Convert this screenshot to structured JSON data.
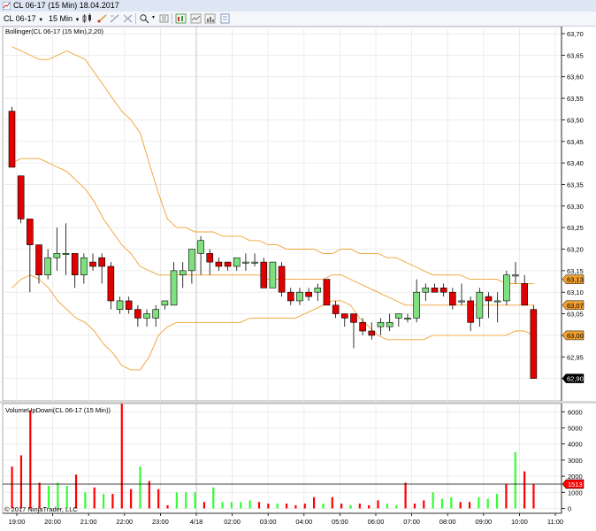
{
  "window": {
    "title": "CL 06-17 (15 Min)",
    "date": "18.04.2017"
  },
  "toolbar": {
    "instrument": "CL 06-17",
    "interval": "15 Min"
  },
  "icons": [
    "chart-app-icon",
    "instrument-dropdown-icon",
    "interval-dropdown-icon",
    "bar-type-icon",
    "drawing-tool-icon",
    "pencil-icon",
    "stop-icon",
    "zoom-icon",
    "properties-icon",
    "chart-style-icon",
    "indicators-icon",
    "strategies-icon"
  ],
  "price_panel": {
    "indicator_label": "Bollinger(CL 06-17 (15 Min),2,20)",
    "y_ticks": [
      "63,70",
      "63,65",
      "63,60",
      "63,55",
      "63,50",
      "63,45",
      "63,40",
      "63,35",
      "63,30",
      "63,25",
      "63,20",
      "63,15",
      "63,10",
      "63,05",
      "63,00",
      "62,95",
      "62,90"
    ],
    "markers": [
      {
        "label": "63,13",
        "bg": "#f0a030",
        "fg": "#000000"
      },
      {
        "label": "63,07",
        "bg": "#f0a030",
        "fg": "#000000"
      },
      {
        "label": "63,00",
        "bg": "#f0a030",
        "fg": "#000000"
      },
      {
        "label": "62,90",
        "bg": "#000000",
        "fg": "#ffffff"
      }
    ]
  },
  "volume_panel": {
    "indicator_label": "VolumeUpDown(CL 06-17 (15 Min))",
    "y_ticks": [
      "6000",
      "5000",
      "4000",
      "3000",
      "2000",
      "1000",
      "0"
    ],
    "marker": {
      "label": "1513",
      "bg": "#ff0000",
      "fg": "#ffffff"
    }
  },
  "x_axis": {
    "ticks": [
      "19:00",
      "20:00",
      "21:00",
      "22:00",
      "23:00",
      "4/18",
      "02:00",
      "03:00",
      "04:00",
      "05:00",
      "06:00",
      "07:00",
      "08:00",
      "09:00",
      "10:00",
      "11:00"
    ]
  },
  "copyright": "© 2017 NinjaTrader, LLC",
  "colors": {
    "up_candle": "#7ee07e",
    "down_candle": "#e00000",
    "bollinger_band": "#f0a030",
    "volume_up": "#33ff33",
    "volume_down": "#ff0000",
    "grid": "#e8e8e8"
  },
  "chart_data": [
    {
      "type": "candlestick",
      "title": "Bollinger(CL 06-17 (15 Min),2,20)",
      "x_labels": [
        "19:00",
        "20:00",
        "21:00",
        "22:00",
        "23:00",
        "4/18",
        "02:00",
        "03:00",
        "04:00",
        "05:00",
        "06:00",
        "07:00",
        "08:00",
        "09:00",
        "10:00",
        "11:00"
      ],
      "ylim": [
        62.88,
        63.72
      ],
      "candles": [
        {
          "o": 63.52,
          "h": 63.53,
          "l": 63.39,
          "c": 63.39
        },
        {
          "o": 63.37,
          "h": 63.37,
          "l": 63.26,
          "c": 63.27
        },
        {
          "o": 63.27,
          "h": 63.27,
          "l": 63.1,
          "c": 63.21
        },
        {
          "o": 63.21,
          "h": 63.21,
          "l": 63.12,
          "c": 63.14
        },
        {
          "o": 63.14,
          "h": 63.2,
          "l": 63.13,
          "c": 63.18
        },
        {
          "o": 63.18,
          "h": 63.25,
          "l": 63.15,
          "c": 63.19
        },
        {
          "o": 63.19,
          "h": 63.26,
          "l": 63.14,
          "c": 63.19
        },
        {
          "o": 63.19,
          "h": 63.19,
          "l": 63.11,
          "c": 63.14
        },
        {
          "o": 63.14,
          "h": 63.19,
          "l": 63.12,
          "c": 63.18
        },
        {
          "o": 63.17,
          "h": 63.19,
          "l": 63.15,
          "c": 63.16
        },
        {
          "o": 63.18,
          "h": 63.19,
          "l": 63.12,
          "c": 63.16
        },
        {
          "o": 63.16,
          "h": 63.17,
          "l": 63.06,
          "c": 63.08
        },
        {
          "o": 63.06,
          "h": 63.09,
          "l": 63.05,
          "c": 63.08
        },
        {
          "o": 63.08,
          "h": 63.09,
          "l": 63.05,
          "c": 63.06
        },
        {
          "o": 63.06,
          "h": 63.07,
          "l": 63.02,
          "c": 63.04
        },
        {
          "o": 63.04,
          "h": 63.06,
          "l": 63.02,
          "c": 63.05
        },
        {
          "o": 63.04,
          "h": 63.07,
          "l": 63.02,
          "c": 63.06
        },
        {
          "o": 63.07,
          "h": 63.08,
          "l": 63.06,
          "c": 63.08
        },
        {
          "o": 63.07,
          "h": 63.17,
          "l": 63.07,
          "c": 63.15
        },
        {
          "o": 63.14,
          "h": 63.17,
          "l": 63.11,
          "c": 63.15
        },
        {
          "o": 63.15,
          "h": 63.2,
          "l": 63.12,
          "c": 63.2
        },
        {
          "o": 63.19,
          "h": 63.23,
          "l": 63.14,
          "c": 63.22
        },
        {
          "o": 63.19,
          "h": 63.2,
          "l": 63.14,
          "c": 63.17
        },
        {
          "o": 63.17,
          "h": 63.18,
          "l": 63.15,
          "c": 63.16
        },
        {
          "o": 63.17,
          "h": 63.17,
          "l": 63.15,
          "c": 63.16
        },
        {
          "o": 63.16,
          "h": 63.18,
          "l": 63.15,
          "c": 63.18
        },
        {
          "o": 63.17,
          "h": 63.19,
          "l": 63.15,
          "c": 63.17
        },
        {
          "o": 63.17,
          "h": 63.19,
          "l": 63.16,
          "c": 63.17
        },
        {
          "o": 63.17,
          "h": 63.18,
          "l": 63.11,
          "c": 63.11
        },
        {
          "o": 63.11,
          "h": 63.17,
          "l": 63.11,
          "c": 63.17
        },
        {
          "o": 63.16,
          "h": 63.17,
          "l": 63.09,
          "c": 63.1
        },
        {
          "o": 63.1,
          "h": 63.11,
          "l": 63.07,
          "c": 63.08
        },
        {
          "o": 63.08,
          "h": 63.11,
          "l": 63.07,
          "c": 63.1
        },
        {
          "o": 63.1,
          "h": 63.11,
          "l": 63.08,
          "c": 63.09
        },
        {
          "o": 63.1,
          "h": 63.12,
          "l": 63.08,
          "c": 63.11
        },
        {
          "o": 63.13,
          "h": 63.13,
          "l": 63.07,
          "c": 63.07
        },
        {
          "o": 63.07,
          "h": 63.08,
          "l": 63.04,
          "c": 63.05
        },
        {
          "o": 63.05,
          "h": 63.05,
          "l": 63.02,
          "c": 63.04
        },
        {
          "o": 63.05,
          "h": 63.05,
          "l": 62.97,
          "c": 63.03
        },
        {
          "o": 63.03,
          "h": 63.04,
          "l": 63.0,
          "c": 63.01
        },
        {
          "o": 63.01,
          "h": 63.03,
          "l": 62.99,
          "c": 63.0
        },
        {
          "o": 63.02,
          "h": 63.04,
          "l": 63.0,
          "c": 63.03
        },
        {
          "o": 63.02,
          "h": 63.05,
          "l": 63.01,
          "c": 63.03
        },
        {
          "o": 63.04,
          "h": 63.05,
          "l": 63.02,
          "c": 63.05
        },
        {
          "o": 63.04,
          "h": 63.05,
          "l": 63.03,
          "c": 63.04
        },
        {
          "o": 63.04,
          "h": 63.13,
          "l": 63.03,
          "c": 63.1
        },
        {
          "o": 63.1,
          "h": 63.12,
          "l": 63.08,
          "c": 63.11
        },
        {
          "o": 63.11,
          "h": 63.12,
          "l": 63.1,
          "c": 63.1
        },
        {
          "o": 63.11,
          "h": 63.12,
          "l": 63.09,
          "c": 63.1
        },
        {
          "o": 63.1,
          "h": 63.11,
          "l": 63.06,
          "c": 63.07
        },
        {
          "o": 63.08,
          "h": 63.12,
          "l": 63.07,
          "c": 63.08
        },
        {
          "o": 63.08,
          "h": 63.09,
          "l": 63.01,
          "c": 63.03
        },
        {
          "o": 63.04,
          "h": 63.11,
          "l": 63.02,
          "c": 63.1
        },
        {
          "o": 63.09,
          "h": 63.1,
          "l": 63.04,
          "c": 63.08
        },
        {
          "o": 63.08,
          "h": 63.1,
          "l": 63.03,
          "c": 63.08
        },
        {
          "o": 63.08,
          "h": 63.15,
          "l": 63.07,
          "c": 63.14
        },
        {
          "o": 63.14,
          "h": 63.17,
          "l": 63.12,
          "c": 63.14
        },
        {
          "o": 63.12,
          "h": 63.14,
          "l": 63.07,
          "c": 63.07
        },
        {
          "o": 63.06,
          "h": 63.07,
          "l": 62.9,
          "c": 62.9
        }
      ],
      "upper_band": [
        63.67,
        63.66,
        63.65,
        63.64,
        63.64,
        63.65,
        63.66,
        63.65,
        63.64,
        63.61,
        63.58,
        63.55,
        63.52,
        63.5,
        63.47,
        63.4,
        63.33,
        63.27,
        63.25,
        63.25,
        63.24,
        63.24,
        63.24,
        63.23,
        63.23,
        63.23,
        63.22,
        63.22,
        63.21,
        63.21,
        63.2,
        63.2,
        63.2,
        63.2,
        63.19,
        63.19,
        63.2,
        63.2,
        63.19,
        63.19,
        63.19,
        63.18,
        63.18,
        63.17,
        63.16,
        63.15,
        63.14,
        63.14,
        63.14,
        63.14,
        63.13,
        63.13,
        63.13,
        63.13,
        63.12,
        63.12,
        63.12,
        63.12
      ],
      "middle_band": [
        63.4,
        63.41,
        63.41,
        63.41,
        63.4,
        63.39,
        63.38,
        63.36,
        63.34,
        63.31,
        63.27,
        63.24,
        63.21,
        63.19,
        63.16,
        63.15,
        63.14,
        63.14,
        63.14,
        63.14,
        63.14,
        63.14,
        63.14,
        63.14,
        63.14,
        63.14,
        63.14,
        63.14,
        63.13,
        63.13,
        63.13,
        63.13,
        63.13,
        63.13,
        63.13,
        63.14,
        63.14,
        63.13,
        63.12,
        63.11,
        63.1,
        63.09,
        63.08,
        63.07,
        63.07,
        63.07,
        63.07,
        63.07,
        63.07,
        63.07,
        63.07,
        63.07,
        63.07,
        63.07,
        63.07,
        63.07,
        63.07,
        63.07
      ],
      "lower_band": [
        63.11,
        63.13,
        63.14,
        63.13,
        63.11,
        63.08,
        63.06,
        63.04,
        63.03,
        63.01,
        62.98,
        62.96,
        62.93,
        62.92,
        62.92,
        62.95,
        63.0,
        63.02,
        63.03,
        63.03,
        63.03,
        63.03,
        63.03,
        63.03,
        63.03,
        63.03,
        63.04,
        63.04,
        63.04,
        63.04,
        63.04,
        63.04,
        63.05,
        63.06,
        63.07,
        63.08,
        63.08,
        63.07,
        63.04,
        63.02,
        63.0,
        62.99,
        62.99,
        62.99,
        62.99,
        62.99,
        63.0,
        63.0,
        63.0,
        63.0,
        63.0,
        63.0,
        63.0,
        63.0,
        63.0,
        63.01,
        63.01,
        63.0
      ]
    },
    {
      "type": "bar",
      "title": "VolumeUpDown(CL 06-17 (15 Min))",
      "ylim": [
        0,
        6500
      ],
      "series": [
        {
          "name": "up",
          "values": [
            0,
            0,
            0,
            0,
            1400,
            1600,
            1400,
            0,
            1000,
            0,
            900,
            0,
            0,
            0,
            2600,
            0,
            0,
            0,
            1000,
            1000,
            1000,
            0,
            1300,
            400,
            400,
            400,
            500,
            0,
            0,
            300,
            0,
            0,
            0,
            0,
            300,
            0,
            0,
            200,
            0,
            0,
            0,
            300,
            200,
            0,
            0,
            0,
            1000,
            600,
            700,
            0,
            0,
            700,
            600,
            900,
            0,
            3500,
            0,
            0
          ]
        },
        {
          "name": "down",
          "values": [
            2600,
            3300,
            6100,
            1600,
            0,
            0,
            0,
            2100,
            0,
            1300,
            0,
            900,
            6500,
            1200,
            0,
            1700,
            1200,
            200,
            0,
            0,
            0,
            400,
            0,
            0,
            0,
            0,
            0,
            400,
            300,
            0,
            300,
            200,
            300,
            700,
            0,
            700,
            300,
            200,
            300,
            200,
            500,
            0,
            0,
            1600,
            300,
            500,
            0,
            0,
            0,
            400,
            400,
            0,
            0,
            0,
            1500,
            0,
            2300,
            1500
          ]
        }
      ],
      "last_value": 1513
    }
  ]
}
